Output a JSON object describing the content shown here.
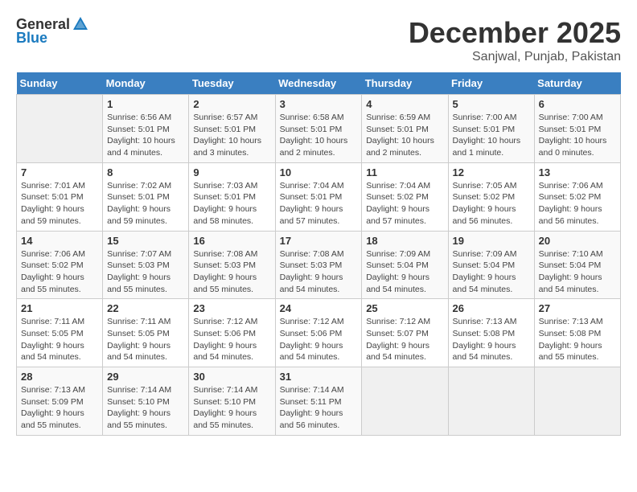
{
  "header": {
    "logo_general": "General",
    "logo_blue": "Blue",
    "title": "December 2025",
    "subtitle": "Sanjwal, Punjab, Pakistan"
  },
  "calendar": {
    "days_of_week": [
      "Sunday",
      "Monday",
      "Tuesday",
      "Wednesday",
      "Thursday",
      "Friday",
      "Saturday"
    ],
    "weeks": [
      [
        {
          "day": "",
          "sunrise": "",
          "sunset": "",
          "daylight": ""
        },
        {
          "day": "1",
          "sunrise": "Sunrise: 6:56 AM",
          "sunset": "Sunset: 5:01 PM",
          "daylight": "Daylight: 10 hours and 4 minutes."
        },
        {
          "day": "2",
          "sunrise": "Sunrise: 6:57 AM",
          "sunset": "Sunset: 5:01 PM",
          "daylight": "Daylight: 10 hours and 3 minutes."
        },
        {
          "day": "3",
          "sunrise": "Sunrise: 6:58 AM",
          "sunset": "Sunset: 5:01 PM",
          "daylight": "Daylight: 10 hours and 2 minutes."
        },
        {
          "day": "4",
          "sunrise": "Sunrise: 6:59 AM",
          "sunset": "Sunset: 5:01 PM",
          "daylight": "Daylight: 10 hours and 2 minutes."
        },
        {
          "day": "5",
          "sunrise": "Sunrise: 7:00 AM",
          "sunset": "Sunset: 5:01 PM",
          "daylight": "Daylight: 10 hours and 1 minute."
        },
        {
          "day": "6",
          "sunrise": "Sunrise: 7:00 AM",
          "sunset": "Sunset: 5:01 PM",
          "daylight": "Daylight: 10 hours and 0 minutes."
        }
      ],
      [
        {
          "day": "7",
          "sunrise": "Sunrise: 7:01 AM",
          "sunset": "Sunset: 5:01 PM",
          "daylight": "Daylight: 9 hours and 59 minutes."
        },
        {
          "day": "8",
          "sunrise": "Sunrise: 7:02 AM",
          "sunset": "Sunset: 5:01 PM",
          "daylight": "Daylight: 9 hours and 59 minutes."
        },
        {
          "day": "9",
          "sunrise": "Sunrise: 7:03 AM",
          "sunset": "Sunset: 5:01 PM",
          "daylight": "Daylight: 9 hours and 58 minutes."
        },
        {
          "day": "10",
          "sunrise": "Sunrise: 7:04 AM",
          "sunset": "Sunset: 5:01 PM",
          "daylight": "Daylight: 9 hours and 57 minutes."
        },
        {
          "day": "11",
          "sunrise": "Sunrise: 7:04 AM",
          "sunset": "Sunset: 5:02 PM",
          "daylight": "Daylight: 9 hours and 57 minutes."
        },
        {
          "day": "12",
          "sunrise": "Sunrise: 7:05 AM",
          "sunset": "Sunset: 5:02 PM",
          "daylight": "Daylight: 9 hours and 56 minutes."
        },
        {
          "day": "13",
          "sunrise": "Sunrise: 7:06 AM",
          "sunset": "Sunset: 5:02 PM",
          "daylight": "Daylight: 9 hours and 56 minutes."
        }
      ],
      [
        {
          "day": "14",
          "sunrise": "Sunrise: 7:06 AM",
          "sunset": "Sunset: 5:02 PM",
          "daylight": "Daylight: 9 hours and 55 minutes."
        },
        {
          "day": "15",
          "sunrise": "Sunrise: 7:07 AM",
          "sunset": "Sunset: 5:03 PM",
          "daylight": "Daylight: 9 hours and 55 minutes."
        },
        {
          "day": "16",
          "sunrise": "Sunrise: 7:08 AM",
          "sunset": "Sunset: 5:03 PM",
          "daylight": "Daylight: 9 hours and 55 minutes."
        },
        {
          "day": "17",
          "sunrise": "Sunrise: 7:08 AM",
          "sunset": "Sunset: 5:03 PM",
          "daylight": "Daylight: 9 hours and 54 minutes."
        },
        {
          "day": "18",
          "sunrise": "Sunrise: 7:09 AM",
          "sunset": "Sunset: 5:04 PM",
          "daylight": "Daylight: 9 hours and 54 minutes."
        },
        {
          "day": "19",
          "sunrise": "Sunrise: 7:09 AM",
          "sunset": "Sunset: 5:04 PM",
          "daylight": "Daylight: 9 hours and 54 minutes."
        },
        {
          "day": "20",
          "sunrise": "Sunrise: 7:10 AM",
          "sunset": "Sunset: 5:04 PM",
          "daylight": "Daylight: 9 hours and 54 minutes."
        }
      ],
      [
        {
          "day": "21",
          "sunrise": "Sunrise: 7:11 AM",
          "sunset": "Sunset: 5:05 PM",
          "daylight": "Daylight: 9 hours and 54 minutes."
        },
        {
          "day": "22",
          "sunrise": "Sunrise: 7:11 AM",
          "sunset": "Sunset: 5:05 PM",
          "daylight": "Daylight: 9 hours and 54 minutes."
        },
        {
          "day": "23",
          "sunrise": "Sunrise: 7:12 AM",
          "sunset": "Sunset: 5:06 PM",
          "daylight": "Daylight: 9 hours and 54 minutes."
        },
        {
          "day": "24",
          "sunrise": "Sunrise: 7:12 AM",
          "sunset": "Sunset: 5:06 PM",
          "daylight": "Daylight: 9 hours and 54 minutes."
        },
        {
          "day": "25",
          "sunrise": "Sunrise: 7:12 AM",
          "sunset": "Sunset: 5:07 PM",
          "daylight": "Daylight: 9 hours and 54 minutes."
        },
        {
          "day": "26",
          "sunrise": "Sunrise: 7:13 AM",
          "sunset": "Sunset: 5:08 PM",
          "daylight": "Daylight: 9 hours and 54 minutes."
        },
        {
          "day": "27",
          "sunrise": "Sunrise: 7:13 AM",
          "sunset": "Sunset: 5:08 PM",
          "daylight": "Daylight: 9 hours and 55 minutes."
        }
      ],
      [
        {
          "day": "28",
          "sunrise": "Sunrise: 7:13 AM",
          "sunset": "Sunset: 5:09 PM",
          "daylight": "Daylight: 9 hours and 55 minutes."
        },
        {
          "day": "29",
          "sunrise": "Sunrise: 7:14 AM",
          "sunset": "Sunset: 5:10 PM",
          "daylight": "Daylight: 9 hours and 55 minutes."
        },
        {
          "day": "30",
          "sunrise": "Sunrise: 7:14 AM",
          "sunset": "Sunset: 5:10 PM",
          "daylight": "Daylight: 9 hours and 55 minutes."
        },
        {
          "day": "31",
          "sunrise": "Sunrise: 7:14 AM",
          "sunset": "Sunset: 5:11 PM",
          "daylight": "Daylight: 9 hours and 56 minutes."
        },
        {
          "day": "",
          "sunrise": "",
          "sunset": "",
          "daylight": ""
        },
        {
          "day": "",
          "sunrise": "",
          "sunset": "",
          "daylight": ""
        },
        {
          "day": "",
          "sunrise": "",
          "sunset": "",
          "daylight": ""
        }
      ]
    ]
  }
}
